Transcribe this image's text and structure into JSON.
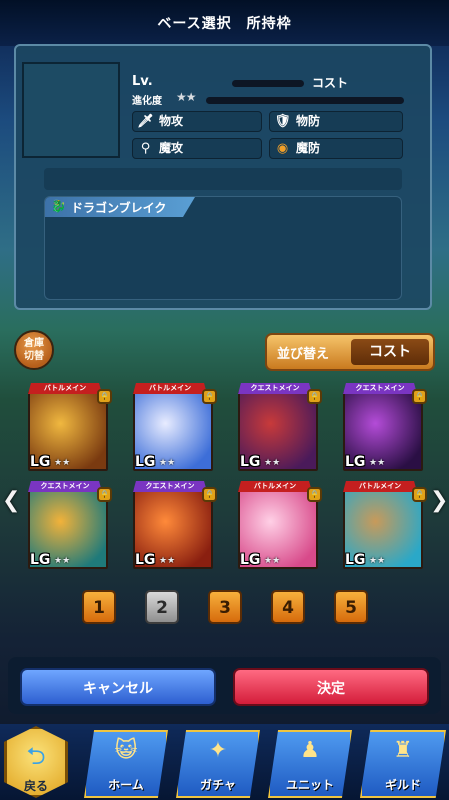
{
  "header": {
    "title": "ベース選択　所持枠"
  },
  "detail": {
    "lv_label": "Lv.",
    "cost_label": "コスト",
    "evolution_label": "進化度",
    "evolution_stars": "★★",
    "stats": [
      {
        "label": "物攻",
        "icon": "sword-icon"
      },
      {
        "label": "物防",
        "icon": "shield-icon"
      },
      {
        "label": "魔攻",
        "icon": "wand-icon"
      },
      {
        "label": "魔防",
        "icon": "magic-shield-icon"
      }
    ],
    "skill_name": "ドラゴンブレイク",
    "skill_icon": "dragon-icon"
  },
  "controls": {
    "warehouse_button": "倉庫\n切替",
    "sort_label": "並び替え",
    "sort_value": "コスト"
  },
  "cards": [
    {
      "tag": "バトルメイン",
      "tag_color": "#c51f1f",
      "rarity": "LG",
      "stars": "★★",
      "colors": [
        "#f0b840",
        "#7a3a10"
      ]
    },
    {
      "tag": "バトルメイン",
      "tag_color": "#c51f1f",
      "rarity": "LG",
      "stars": "★★",
      "colors": [
        "#e8ecff",
        "#3d6ed8"
      ]
    },
    {
      "tag": "クエストメイン",
      "tag_color": "#7a35c2",
      "rarity": "LG",
      "stars": "★★",
      "colors": [
        "#c83a3a",
        "#4a1a5a"
      ]
    },
    {
      "tag": "クエストメイン",
      "tag_color": "#7a35c2",
      "rarity": "LG",
      "stars": "★★",
      "colors": [
        "#b44cd8",
        "#2a0f44"
      ]
    },
    {
      "tag": "クエストメイン",
      "tag_color": "#7a35c2",
      "rarity": "LG",
      "stars": "★★",
      "colors": [
        "#f2b23a",
        "#1f7a7a"
      ]
    },
    {
      "tag": "クエストメイン",
      "tag_color": "#7a35c2",
      "rarity": "LG",
      "stars": "★★",
      "colors": [
        "#ff8a3a",
        "#8a1f10"
      ]
    },
    {
      "tag": "バトルメイン",
      "tag_color": "#c51f1f",
      "rarity": "LG",
      "stars": "★★",
      "colors": [
        "#ffd0e6",
        "#d84a8a"
      ]
    },
    {
      "tag": "バトルメイン",
      "tag_color": "#c51f1f",
      "rarity": "LG",
      "stars": "★★",
      "colors": [
        "#c89a5a",
        "#2aa8c8"
      ]
    }
  ],
  "arrows": {
    "left": "❮",
    "right": "❯"
  },
  "pagination": {
    "pages": [
      "1",
      "2",
      "3",
      "4",
      "5"
    ],
    "selected": "2"
  },
  "actions": {
    "cancel": "キャンセル",
    "confirm": "決定"
  },
  "nav": {
    "back": {
      "label": "戻る",
      "icon": "back-arrow-icon"
    },
    "items": [
      {
        "label": "ホーム",
        "icon": "cat-face-icon"
      },
      {
        "label": "ガチャ",
        "icon": "summon-icon"
      },
      {
        "label": "ユニット",
        "icon": "unit-icon"
      },
      {
        "label": "ギルド",
        "icon": "castle-icon"
      }
    ]
  },
  "colors": {
    "accent_orange": "#d66b0c",
    "cancel_blue": "#2d5fd0",
    "confirm_red": "#d41d3a",
    "nav_blue": "#1f5bc2"
  }
}
